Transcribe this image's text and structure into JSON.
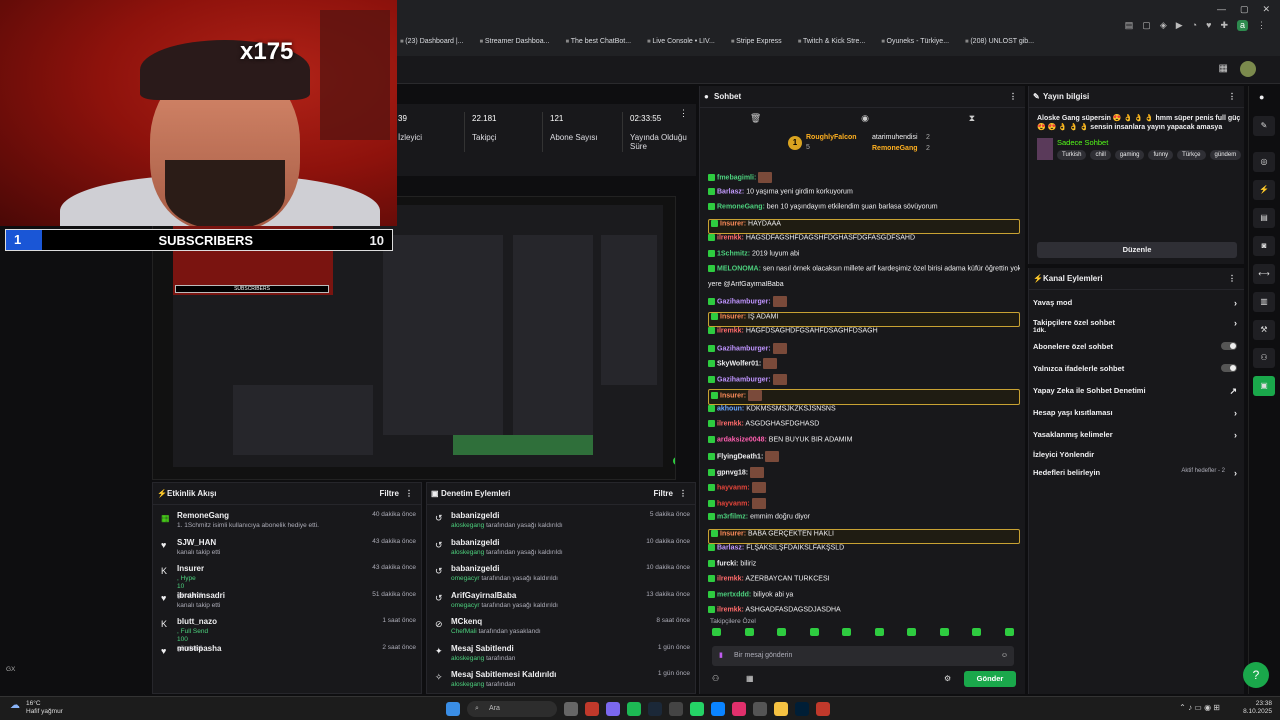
{
  "browser": {
    "bookmarks": [
      "(23) Dashboard |...",
      "Streamer Dashboa...",
      "The best ChatBot...",
      "Live Console • LIV...",
      "Stripe Express",
      "Twitch & Kick Stre...",
      "Oyuneks - Türkiye...",
      "(208) UNLOST gib..."
    ]
  },
  "overlay": {
    "multiplier": "x175",
    "sub_current": "1",
    "sub_label": "SUBSCRIBERS",
    "sub_goal": "10"
  },
  "stats": [
    {
      "value": "39",
      "label": "İzleyici"
    },
    {
      "value": "22.181",
      "label": "Takipçi"
    },
    {
      "value": "121",
      "label": "Abone Sayısı"
    },
    {
      "value": "02:33:55",
      "label": "Yayında Olduğu Süre"
    }
  ],
  "activity": {
    "title": "Etkinlik Akışı",
    "filter": "Filtre",
    "items": [
      {
        "icon": "gift-icon",
        "name": "RemoneGang",
        "time": "40 dakika önce",
        "l1": "1. 1Schmitz isimli kullanıcıya abonelik hediye etti.",
        "l2": "",
        "l3": ""
      },
      {
        "icon": "heart-icon",
        "name": "SJW_HAN",
        "time": "43 dakika önce",
        "l1": "kanalı takip etti",
        "l2": "",
        "l3": ""
      },
      {
        "icon": "kick-icon",
        "name": "Insurer",
        "time": "43 dakika önce",
        "l1": ", Hype",
        "l2": "10",
        "l3": "gönderdi"
      },
      {
        "icon": "heart-icon",
        "name": "ibrahimsadri",
        "time": "51 dakika önce",
        "l1": "kanalı takip etti",
        "l2": "",
        "l3": ""
      },
      {
        "icon": "kick-icon",
        "name": "blutt_nazo",
        "time": "1 saat önce",
        "l1": ", Full Send",
        "l2": "100",
        "l3": "gönderdi"
      },
      {
        "icon": "heart-icon",
        "name": "mustipasha",
        "time": "2 saat önce",
        "l1": "",
        "l2": "",
        "l3": ""
      }
    ]
  },
  "moderation": {
    "title": "Denetim Eylemleri",
    "filter": "Filtre",
    "items": [
      {
        "icon": "undo-icon",
        "name": "babanizgeldi",
        "time": "5 dakika önce",
        "by": "aloskegang",
        "text": "tarafından yasağı kaldırıldı"
      },
      {
        "icon": "undo-icon",
        "name": "babanizgeldi",
        "time": "10 dakika önce",
        "by": "aloskegang",
        "text": "tarafından yasağı kaldırıldı"
      },
      {
        "icon": "undo-icon",
        "name": "babanizgeldi",
        "time": "10 dakika önce",
        "by": "omegacyr",
        "text": "tarafından yasağı kaldırıldı"
      },
      {
        "icon": "undo-icon",
        "name": "ArifGayirnalBaba",
        "time": "13 dakika önce",
        "by": "omegacyr",
        "text": "tarafından yasağı kaldırıldı"
      },
      {
        "icon": "ban-icon",
        "name": "MCkenq",
        "time": "8 saat önce",
        "by": "ChefMali",
        "text": "tarafından yasaklandı"
      },
      {
        "icon": "pin-icon",
        "name": "Mesaj Sabitlendi",
        "time": "1 gün önce",
        "by": "aloskegang",
        "text": "tarafından"
      },
      {
        "icon": "unpin-icon",
        "name": "Mesaj Sabitlemesi Kaldırıldı",
        "time": "1 gün önce",
        "by": "aloskegang",
        "text": "tarafından"
      }
    ]
  },
  "chat": {
    "title": "Sohbet",
    "leaderboard": [
      {
        "name": "RoughlyFalcon",
        "count": "5"
      },
      {
        "name": "atarimuhendisi",
        "count": "2"
      },
      {
        "name": "RemoneGang",
        "count": "2"
      }
    ],
    "messages": [
      {
        "user": "fmebagimli:",
        "color": "#4cd07d",
        "text": "",
        "emote": true,
        "hl": false
      },
      {
        "user": "Barlasz:",
        "color": "#c39bff",
        "text": "10 yaşıma yeni girdim korkuyorum",
        "emote": false,
        "hl": false
      },
      {
        "user": "RemoneGang:",
        "color": "#4cd07d",
        "text": "ben 10 yaşındayım etkilendim şuan barlasa sövüyorum",
        "emote": false,
        "hl": false
      },
      {
        "user": "Insurer:",
        "color": "#ff8c5a",
        "text": "HAYDAAA",
        "emote": false,
        "hl": true
      },
      {
        "user": "ilremkk:",
        "color": "#ff6b6b",
        "text": "HAGSDFAGSHFDAGSHFDGHASFDGFASGDFSAHD",
        "emote": false,
        "hl": false
      },
      {
        "user": "1Schmitz:",
        "color": "#4cd07d",
        "text": "2019 luyum abi",
        "emote": false,
        "hl": false
      },
      {
        "user": "MELONOMA:",
        "color": "#4cd07d",
        "text": "sen nasıl örnek olacaksın millete arif kardeşimiz özel birisi adama küfür öğrettin yok",
        "emote": false,
        "hl": false
      },
      {
        "user": "",
        "color": "#efeff1",
        "text": "yere @ArifGayirnalBaba",
        "emote": false,
        "hl": false
      },
      {
        "user": "Gazihamburger:",
        "color": "#bf94ff",
        "text": "",
        "emote": true,
        "hl": false
      },
      {
        "user": "Insurer:",
        "color": "#ff8c5a",
        "text": "İŞ ADAMI",
        "emote": false,
        "hl": true
      },
      {
        "user": "ilremkk:",
        "color": "#ff6b6b",
        "text": "HAGFDSAGHDFGSAHFDSAGHFDSAGH",
        "emote": false,
        "hl": false
      },
      {
        "user": "Gazihamburger:",
        "color": "#bf94ff",
        "text": "",
        "emote": true,
        "hl": false
      },
      {
        "user": "SkyWolfer01:",
        "color": "#efeff1",
        "text": "",
        "emote": true,
        "hl": false
      },
      {
        "user": "Gazihamburger:",
        "color": "#bf94ff",
        "text": "",
        "emote": true,
        "hl": false
      },
      {
        "user": "Insurer:",
        "color": "#ff8c5a",
        "text": "",
        "emote": true,
        "hl": true
      },
      {
        "user": "akhoun:",
        "color": "#6ba8ff",
        "text": "KDKMSSMSJKZKSJSNSNS",
        "emote": false,
        "hl": false
      },
      {
        "user": "ilremkk:",
        "color": "#ff6b6b",
        "text": "ASGDGHASFDGHASD",
        "emote": false,
        "hl": false
      },
      {
        "user": "ardaksize0048:",
        "color": "#ff5fb0",
        "text": "BEN BÜYÜK BİR ADAMIM",
        "emote": false,
        "hl": false
      },
      {
        "user": "FlyingDeath1:",
        "color": "#efeff1",
        "text": "",
        "emote": true,
        "hl": false
      },
      {
        "user": "gpnvg18:",
        "color": "#efeff1",
        "text": "",
        "emote": true,
        "hl": false
      },
      {
        "user": "hayvanm:",
        "color": "#e5453a",
        "text": "",
        "emote": true,
        "hl": false
      },
      {
        "user": "hayvanm:",
        "color": "#e5453a",
        "text": "",
        "emote": true,
        "hl": false
      },
      {
        "user": "m3rfilmz:",
        "color": "#4cd07d",
        "text": "emmim doğru diyor",
        "emote": false,
        "hl": false
      },
      {
        "user": "Insurer:",
        "color": "#ff8c5a",
        "text": "BABA GERÇEKTEN HAKLI",
        "emote": false,
        "hl": true
      },
      {
        "user": "Barlasz:",
        "color": "#c39bff",
        "text": "FLŞAKSİLŞFDAİKSLFAKŞSLD",
        "emote": false,
        "hl": false
      },
      {
        "user": "furcki:",
        "color": "#efeff1",
        "text": "biliriz",
        "emote": false,
        "hl": false
      },
      {
        "user": "ilremkk:",
        "color": "#ff6b6b",
        "text": "AZERBAYCAN TURKCESİ",
        "emote": false,
        "hl": false
      },
      {
        "user": "mertxddd:",
        "color": "#4cd07d",
        "text": "biliyok abi ya",
        "emote": false,
        "hl": false
      },
      {
        "user": "ilremkk:",
        "color": "#ff6b6b",
        "text": "ASHGADFASDAGSDJASDHA",
        "emote": false,
        "hl": false
      }
    ],
    "followers_only": "Takipçilere Özel",
    "input_placeholder": "Bir mesaj gönderin",
    "send_label": "Gönder"
  },
  "stream_info": {
    "title": "Yayın bilgisi",
    "stream_title": "Aloske Gang süpersin 😍 👌 👌 👌 hmm süper penis full güç 😍 😍 👌 👌 👌 sensin insanlara yayın yapacak amasya",
    "category": "Sadece Sohbet",
    "tags": [
      "Turkish",
      "chill",
      "gaming",
      "funny",
      "Türkçe",
      "gündem"
    ],
    "edit_label": "Düzenle"
  },
  "channel_actions": {
    "title": "Kanal Eylemleri",
    "items": [
      {
        "label": "Yavaş mod",
        "sub": "",
        "control": "arrow"
      },
      {
        "label": "Takipçilere özel sohbet",
        "sub": "1dk.",
        "control": "arrow"
      },
      {
        "label": "Abonelere özel sohbet",
        "sub": "",
        "control": "toggle"
      },
      {
        "label": "Yalnızca ifadelerle sohbet",
        "sub": "",
        "control": "toggle"
      },
      {
        "label": "Yapay Zeka ile Sohbet Denetimi",
        "sub": "",
        "control": "ext"
      },
      {
        "label": "Hesap yaşı kısıtlaması",
        "sub": "",
        "control": "arrow"
      },
      {
        "label": "Yasaklanmış kelimeler",
        "sub": "",
        "control": "arrow"
      },
      {
        "label": "İzleyici Yönlendir",
        "sub": "",
        "control": "none"
      },
      {
        "label": "Hedefleri belirleyin",
        "sub": "",
        "control": "arrow",
        "extra": "Aktif hedefler - 2"
      }
    ]
  },
  "taskbar": {
    "weather_temp": "16°C",
    "weather_desc": "Hafif yağmur",
    "search": "Ara",
    "time": "23:38",
    "date": "8.10.2025"
  },
  "colors": {
    "accent": "#53fc18",
    "kick_green": "#1aa84b",
    "highlight": "#c8a233"
  }
}
